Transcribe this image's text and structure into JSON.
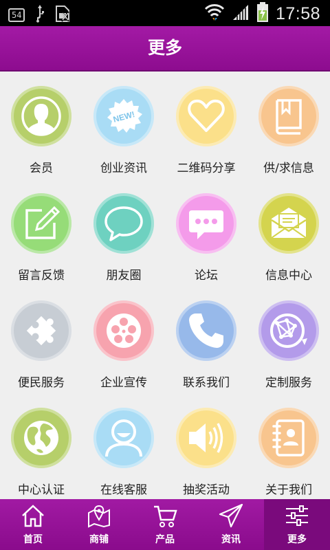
{
  "status_bar": {
    "badge": "54",
    "time": "17:58",
    "icons": [
      "usb-icon",
      "sim-icon",
      "wifi-icon",
      "signal-icon",
      "battery-charging-icon"
    ]
  },
  "header": {
    "title": "更多"
  },
  "grid": {
    "items": [
      {
        "label": "会员",
        "icon": "person-icon",
        "color": "#b6cf6a"
      },
      {
        "label": "创业资讯",
        "icon": "new-badge-icon",
        "color": "#a9dcf5"
      },
      {
        "label": "二维码分享",
        "icon": "heart-icon",
        "color": "#fbe08a"
      },
      {
        "label": "供/求信息",
        "icon": "book-icon",
        "color": "#f8c58e"
      },
      {
        "label": "留言反馈",
        "icon": "edit-icon",
        "color": "#96dc78"
      },
      {
        "label": "朋友圈",
        "icon": "chat-bubble-icon",
        "color": "#6ed1c0"
      },
      {
        "label": "论坛",
        "icon": "message-dots-icon",
        "color": "#f49bea"
      },
      {
        "label": "信息中心",
        "icon": "envelope-icon",
        "color": "#d4d44e"
      },
      {
        "label": "便民服务",
        "icon": "puzzle-icon",
        "color": "#c7cdd4"
      },
      {
        "label": "企业宣传",
        "icon": "film-reel-icon",
        "color": "#f7a3ae"
      },
      {
        "label": "联系我们",
        "icon": "phone-icon",
        "color": "#97b9ea"
      },
      {
        "label": "定制服务",
        "icon": "globe-network-icon",
        "color": "#b39bea"
      },
      {
        "label": "中心认证",
        "icon": "globe-icon",
        "color": "#b6cf6a"
      },
      {
        "label": "在线客服",
        "icon": "support-agent-icon",
        "color": "#a9dcf5"
      },
      {
        "label": "抽奖活动",
        "icon": "speaker-icon",
        "color": "#fbe08a"
      },
      {
        "label": "关于我们",
        "icon": "contacts-book-icon",
        "color": "#f8c58e"
      }
    ]
  },
  "bottom_nav": {
    "items": [
      {
        "label": "首页",
        "icon": "home-icon"
      },
      {
        "label": "商铺",
        "icon": "map-pin-icon"
      },
      {
        "label": "产品",
        "icon": "cart-icon"
      },
      {
        "label": "资讯",
        "icon": "send-icon"
      },
      {
        "label": "更多",
        "icon": "sliders-icon",
        "active": true
      }
    ]
  },
  "colors": {
    "header": "#981399",
    "nav_active": "#7a0a7c",
    "background": "#efefef"
  }
}
